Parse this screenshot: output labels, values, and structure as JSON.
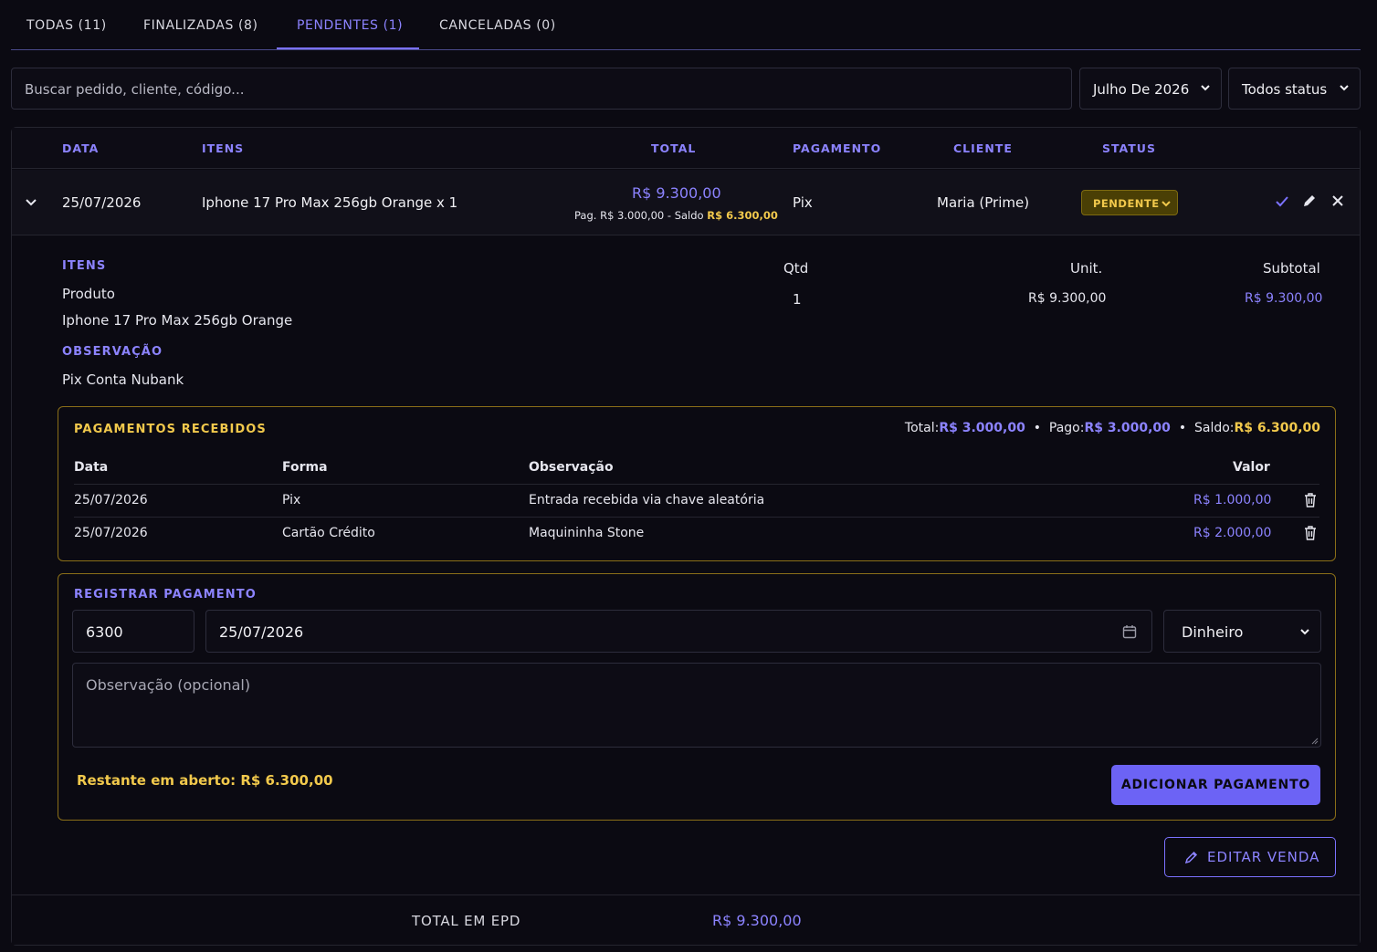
{
  "tabs": [
    {
      "label": "TODAS (11)"
    },
    {
      "label": "FINALIZADAS (8)"
    },
    {
      "label": "PENDENTES (1)"
    },
    {
      "label": "CANCELADAS (0)"
    }
  ],
  "filters": {
    "search_placeholder": "Buscar pedido, cliente, código...",
    "month": "Julho De 2026",
    "status": "Todos status"
  },
  "table": {
    "headers": {
      "data": "DATA",
      "itens": "ITENS",
      "total": "TOTAL",
      "pagamento": "PAGAMENTO",
      "cliente": "CLIENTE",
      "status": "STATUS"
    },
    "row": {
      "date": "25/07/2026",
      "items": "Iphone 17 Pro Max 256gb Orange x 1",
      "total": "R$ 9.300,00",
      "paid_prefix": "Pag. R$ 3.000,00 - Saldo",
      "balance": "R$ 6.300,00",
      "payment": "Pix",
      "client": "Maria (Prime)",
      "status": "PENDENTE"
    }
  },
  "details": {
    "items_label": "ITENS",
    "col_product": "Produto",
    "col_qty": "Qtd",
    "col_unit": "Unit.",
    "col_subtotal": "Subtotal",
    "product": "Iphone 17 Pro Max 256gb Orange",
    "qty": "1",
    "unit": "R$ 9.300,00",
    "subtotal": "R$ 9.300,00",
    "obs_label": "OBSERVAÇÃO",
    "obs": "Pix Conta Nubank"
  },
  "payments": {
    "title": "PAGAMENTOS RECEBIDOS",
    "total_label": "Total:",
    "total": "R$ 3.000,00",
    "paid_label": "Pago:",
    "paid": "R$ 3.000,00",
    "balance_label": "Saldo:",
    "balance": "R$ 6.300,00",
    "headers": {
      "date": "Data",
      "method": "Forma",
      "note": "Observação",
      "value": "Valor"
    },
    "rows": [
      {
        "date": "25/07/2026",
        "method": "Pix",
        "note": "Entrada recebida via chave aleatória",
        "value": "R$ 1.000,00"
      },
      {
        "date": "25/07/2026",
        "method": "Cartão Crédito",
        "note": "Maquininha Stone",
        "value": "R$ 2.000,00"
      }
    ]
  },
  "register": {
    "title": "REGISTRAR PAGAMENTO",
    "amount": "6300",
    "date": "25/07/2026",
    "method": "Dinheiro",
    "note_placeholder": "Observação (opcional)",
    "remaining": "Restante em aberto: R$ 6.300,00",
    "add_button": "ADICIONAR PAGAMENTO"
  },
  "edit_button": "EDITAR VENDA",
  "footer": {
    "label": "TOTAL EM EPD",
    "value": "R$ 9.300,00"
  },
  "colors": {
    "accent": "#7b72ff",
    "warning": "#f2c94c",
    "background": "#0b0a12"
  }
}
